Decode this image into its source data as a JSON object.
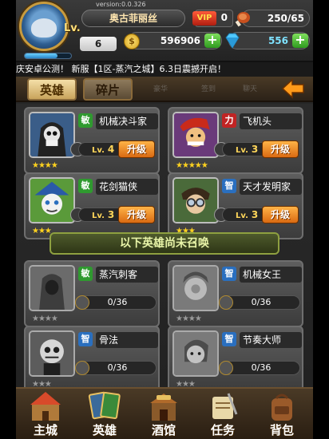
{
  "player": {
    "version": "version:0.0.326",
    "name": "奥古菲丽丝",
    "level_label": "Lv.",
    "level": "6",
    "xp_progress": 0.7,
    "vip_label": "VIP",
    "vip_level": "0",
    "stamina": "250/65",
    "gold": "596906",
    "gems": "556"
  },
  "ticker": "庆安卓公测！ 新服【1区-蒸汽之城】6.3日震撼开启！",
  "tabs": [
    {
      "label": "英雄",
      "active": true
    },
    {
      "label": "碎片",
      "active": false
    }
  ],
  "ghost_tabs": [
    "豪华",
    "签到",
    "聊天"
  ],
  "upgrade_label": "升级",
  "level_prefix": "Lv.",
  "owned_heroes": [
    {
      "name": "机械决斗家",
      "class": "敏",
      "level": "4",
      "stars": "★★★★"
    },
    {
      "name": "飞机头",
      "class": "力",
      "level": "3",
      "stars": "★★★★★"
    },
    {
      "name": "花剑猫侠",
      "class": "敏",
      "level": "3",
      "stars": "★★★"
    },
    {
      "name": "天才发明家",
      "class": "智",
      "level": "3",
      "stars": "★★★"
    }
  ],
  "banner": "以下英雄尚未召唤",
  "locked_heroes": [
    {
      "name": "蒸汽刺客",
      "class": "敏",
      "shards": "0/36",
      "stars": "★★★★"
    },
    {
      "name": "机械女王",
      "class": "智",
      "shards": "0/36",
      "stars": "★★★★"
    },
    {
      "name": "骨法",
      "class": "智",
      "shards": "0/36",
      "stars": "★★★"
    },
    {
      "name": "节奏大师",
      "class": "智",
      "shards": "0/36",
      "stars": "★★★"
    }
  ],
  "nav": [
    {
      "label": "主城",
      "icon": "castle-icon"
    },
    {
      "label": "英雄",
      "icon": "hero-cards-icon"
    },
    {
      "label": "酒馆",
      "icon": "tavern-icon"
    },
    {
      "label": "任务",
      "icon": "quest-scroll-icon"
    },
    {
      "label": "背包",
      "icon": "backpack-icon"
    }
  ],
  "colors": {
    "agility": "#2f9a2f",
    "strength": "#c02424",
    "intellect": "#2a6fbf",
    "upgrade": "#e07a1a"
  }
}
